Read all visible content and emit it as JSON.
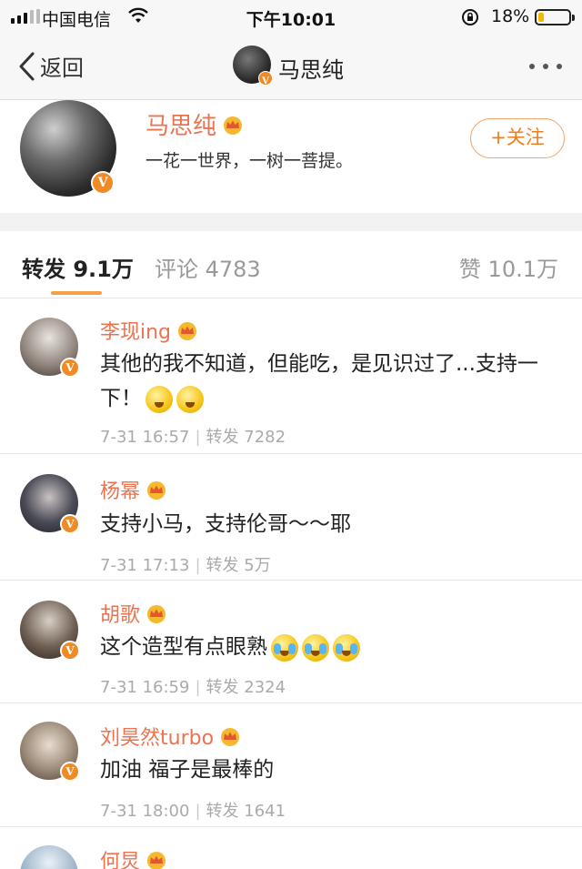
{
  "status_bar": {
    "carrier": "中国电信",
    "time": "下午10:01",
    "battery_percent": "18%",
    "battery_level": 0.18
  },
  "nav": {
    "back_label": "返回",
    "title": "马思纯"
  },
  "profile": {
    "name": "马思纯",
    "bio": "一花一世界，一树一菩提。",
    "follow_label": "+关注",
    "verified_mark": "V"
  },
  "tabs": {
    "repost": "转发 9.1万",
    "comment": "评论 4783",
    "like": "赞 10.1万"
  },
  "reposts": [
    {
      "name": "李现ing",
      "text": "其他的我不知道，但能吃，是见识过了...支持一下！",
      "date": "7-31 16:57",
      "repost_label": "转发 7282"
    },
    {
      "name": "杨幂",
      "text": "支持小马，支持伦哥～～耶",
      "date": "7-31 17:13",
      "repost_label": "转发 5万"
    },
    {
      "name": "胡歌",
      "text": "这个造型有点眼熟",
      "date": "7-31 16:59",
      "repost_label": "转发 2324"
    },
    {
      "name": "刘昊然turbo",
      "text": "加油 福子是最棒的",
      "date": "7-31 18:00",
      "repost_label": "转发 1641"
    },
    {
      "name": "何炅"
    }
  ],
  "colors": {
    "name_orange": "#eb7350",
    "accent_orange": "#f07d1c",
    "tab_underline": "#f7a04c",
    "verified_badge": "#f08a24"
  },
  "icons": {
    "back": "chevron-left-icon",
    "more": "more-dots-icon",
    "crown": "crown-icon",
    "verified": "verified-v-icon",
    "wifi": "wifi-icon",
    "signal": "signal-icon",
    "lock": "orientation-lock-icon",
    "battery": "battery-icon"
  }
}
